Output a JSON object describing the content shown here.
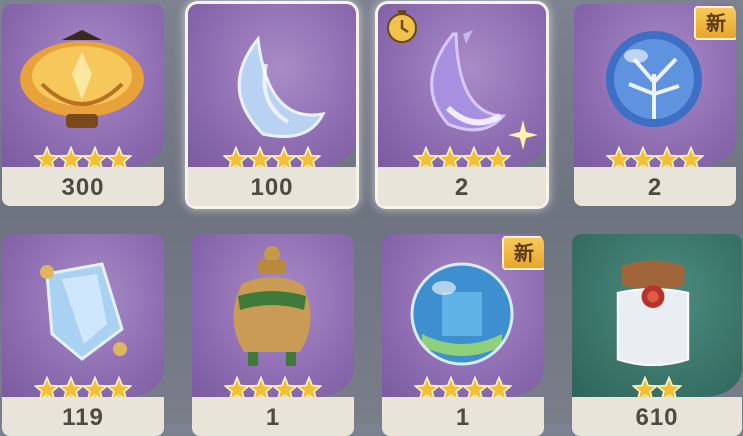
{
  "items": [
    {
      "count": "300",
      "stars": 4,
      "icon": "lantern-icon"
    },
    {
      "count": "100",
      "stars": 4,
      "icon": "crescent-moon-icon"
    },
    {
      "count": "2",
      "stars": 4,
      "icon": "purple-moon-icon"
    },
    {
      "count": "2",
      "stars": 4,
      "icon": "crystal-orb-icon",
      "badge": "新"
    },
    {
      "count": "119",
      "stars": 4,
      "icon": "crystal-shard-icon"
    },
    {
      "count": "1",
      "stars": 4,
      "icon": "bronze-urn-icon"
    },
    {
      "count": "1",
      "stars": 4,
      "icon": "water-globe-icon",
      "badge": "新"
    },
    {
      "count": "610",
      "stars": 2,
      "icon": "sealed-jar-icon"
    }
  ],
  "colors": {
    "purple_bg": "#8f6eb3",
    "green_bg": "#3a7468",
    "footer_bg": "#e9e4d9",
    "star": "#f3bf35",
    "count_text": "#4f4a44"
  }
}
